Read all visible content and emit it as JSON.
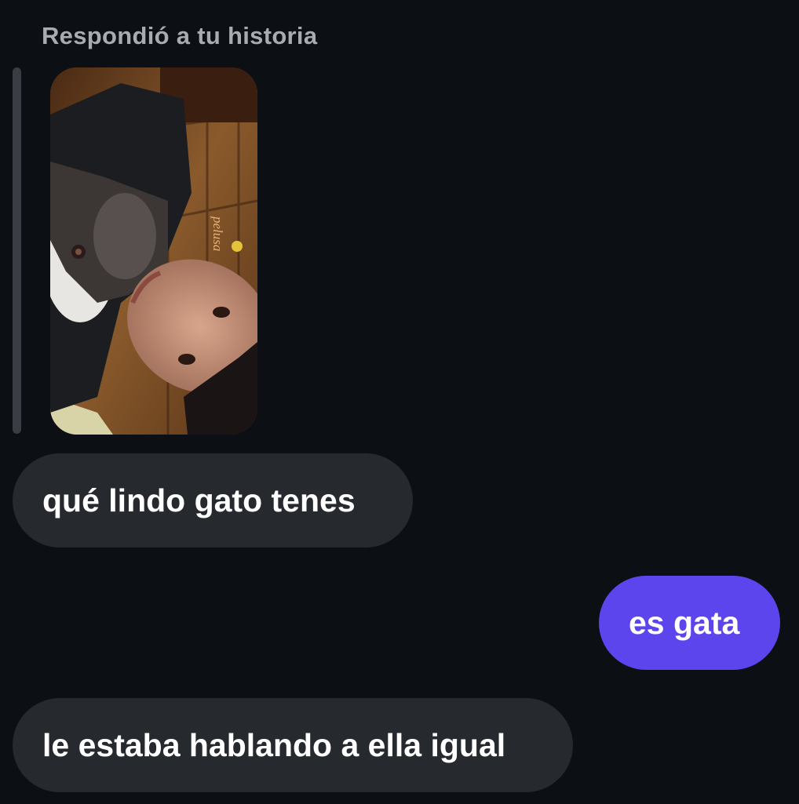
{
  "reply": {
    "label": "Respondió a tu historia"
  },
  "story": {
    "image_alt": "story-photo",
    "sticker_text": "pelusa"
  },
  "messages": [
    {
      "text": "qué lindo gato tenes",
      "direction": "incoming"
    },
    {
      "text": "es gata",
      "direction": "outgoing"
    },
    {
      "text": "le estaba hablando a ella igual",
      "direction": "incoming"
    }
  ],
  "colors": {
    "background": "#0c0f14",
    "incoming_bubble": "#26292e",
    "outgoing_bubble": "#5c45ed",
    "label_text": "#a8abb2",
    "message_text": "#ffffff"
  }
}
